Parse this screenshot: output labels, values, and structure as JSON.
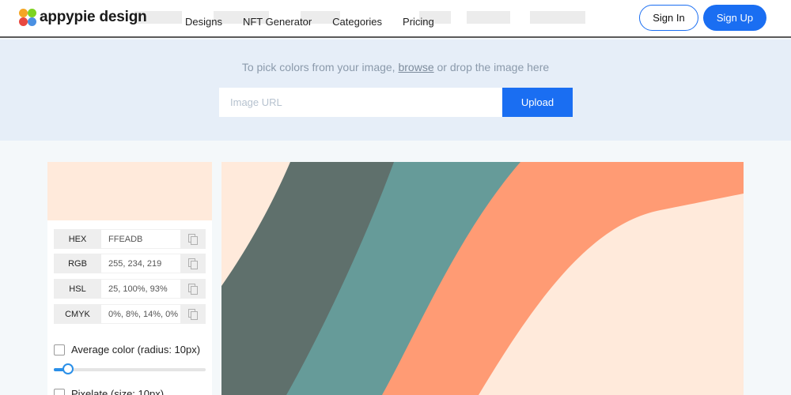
{
  "header": {
    "logo_text": "appypie design",
    "nav": [
      "Designs",
      "NFT Generator",
      "Categories",
      "Pricing"
    ],
    "signin_label": "Sign In",
    "signup_label": "Sign Up"
  },
  "upload": {
    "hint_before": "To pick colors from your image, ",
    "hint_link": "browse",
    "hint_after": " or drop the image here",
    "url_placeholder": "Image URL",
    "upload_label": "Upload"
  },
  "picker": {
    "swatch_color": "#FFEADB",
    "rows": [
      {
        "label": "HEX",
        "value": "FFEADB"
      },
      {
        "label": "RGB",
        "value": "255, 234, 219"
      },
      {
        "label": "HSL",
        "value": "25, 100%, 93%"
      },
      {
        "label": "CMYK",
        "value": "0%, 8%, 14%, 0%"
      }
    ],
    "average_label": "Average color (radius: 10px)",
    "average_radius_px": 10,
    "pixelate_label": "Pixelate (size: 10px)"
  },
  "image": {
    "colors": [
      "#5f706c",
      "#669b99",
      "#ff9b74",
      "#ffeadb"
    ]
  },
  "colors": {
    "accent": "#1a6ef2",
    "band": "#e6eef8",
    "slider": "#2a8fe8"
  },
  "icons": [
    "copy-icon",
    "appypie-logo-icon"
  ]
}
